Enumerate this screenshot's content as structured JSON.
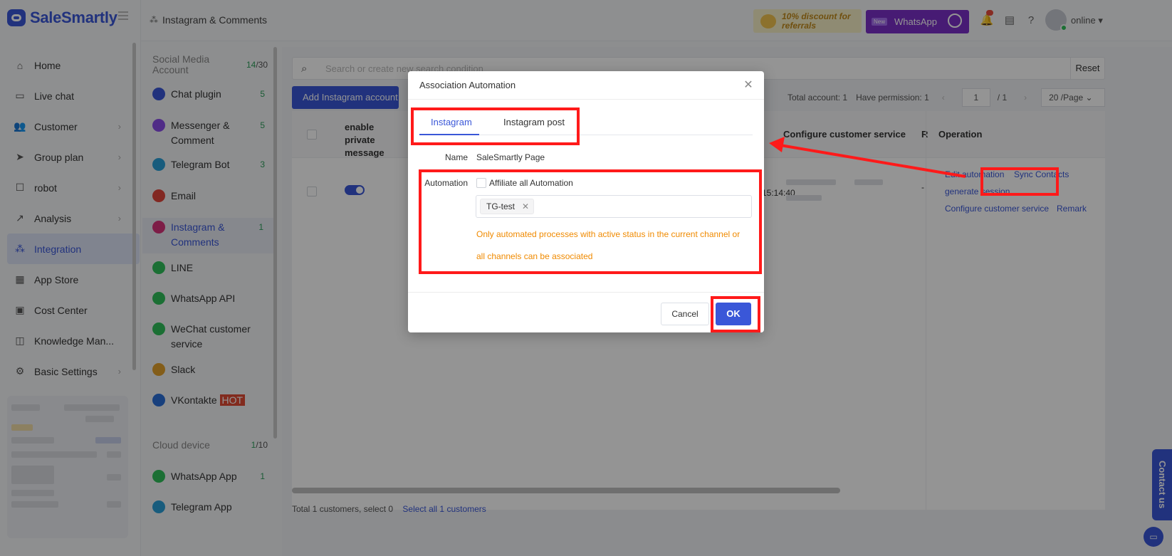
{
  "app": {
    "brand": "SaleSmartly"
  },
  "nav": {
    "items": [
      {
        "label": "Home",
        "icon": "home-icon",
        "glyph": "⌂",
        "chevron": false
      },
      {
        "label": "Live chat",
        "icon": "chat-icon",
        "glyph": "▭",
        "chevron": false
      },
      {
        "label": "Customer",
        "icon": "users-icon",
        "glyph": "👥",
        "chevron": true
      },
      {
        "label": "Group plan",
        "icon": "send-icon",
        "glyph": "➤",
        "chevron": true
      },
      {
        "label": "robot",
        "icon": "robot-icon",
        "glyph": "☐",
        "chevron": true
      },
      {
        "label": "Analysis",
        "icon": "chart-icon",
        "glyph": "↗",
        "chevron": true
      },
      {
        "label": "Integration",
        "icon": "integration-icon",
        "glyph": "⁂",
        "chevron": false,
        "active": true
      },
      {
        "label": "App Store",
        "icon": "apps-icon",
        "glyph": "▦",
        "chevron": false
      },
      {
        "label": "Cost Center",
        "icon": "wallet-icon",
        "glyph": "▣",
        "chevron": false
      },
      {
        "label": "Knowledge Man...",
        "icon": "book-icon",
        "glyph": "◫",
        "chevron": false
      },
      {
        "label": "Basic Settings",
        "icon": "gear-icon",
        "glyph": "⚙",
        "chevron": true
      }
    ],
    "chevron_glyph": "›"
  },
  "topbar": {
    "breadcrumb": "Instagram & Comments",
    "promo_referral": "10% discount for referrals",
    "promo_whatsapp_badge": "New",
    "promo_whatsapp": "WhatsApp",
    "status": "online"
  },
  "subnav": {
    "social_header": "Social Media Account",
    "social_count_used": "14",
    "social_count_total": "/30",
    "items": [
      {
        "label": "Chat plugin",
        "count": "5",
        "color": "#3a57d8"
      },
      {
        "label": "Messenger & Comment",
        "count": "5",
        "color": "#8a4de8"
      },
      {
        "label": "Telegram Bot",
        "count": "3",
        "color": "#2a9fd8"
      },
      {
        "label": "Email",
        "count": "",
        "color": "#e0453b"
      },
      {
        "label": "Instagram & Comments",
        "count": "1",
        "color": "#d8337a",
        "active": true
      },
      {
        "label": "LINE",
        "count": "",
        "color": "#2fbf5b"
      },
      {
        "label": "WhatsApp API",
        "count": "",
        "color": "#2fbf5b"
      },
      {
        "label": "WeChat customer service",
        "count": "",
        "color": "#2fbf5b"
      },
      {
        "label": "Slack",
        "count": "",
        "color": "#e2a12b"
      },
      {
        "label": "VKontakte",
        "count": "",
        "color": "#2a6fd8",
        "hot": "HOT"
      }
    ],
    "cloud_header": "Cloud device",
    "cloud_count_used": "1",
    "cloud_count_total": "/10",
    "cloud_items": [
      {
        "label": "WhatsApp App",
        "count": "1",
        "color": "#2fbf5b"
      },
      {
        "label": "Telegram App",
        "count": "",
        "color": "#2a9fd8"
      }
    ]
  },
  "main": {
    "search_placeholder": "Search or create new search condition",
    "reset": "Reset",
    "add_button": "Add Instagram account",
    "total_account": "Total account: 1",
    "have_permission": "Have permission: 1",
    "page_current": "1",
    "page_total": "/ 1",
    "page_size": "20 /Page",
    "col_enable": "enable private message",
    "col_configure": "Configure customer service",
    "col_r": "R",
    "col_operation": "Operation",
    "time_partial": "15:14:40",
    "dash": "-",
    "ops": {
      "edit_automation": "Edit automation",
      "sync_contacts": "Sync Contacts",
      "generate_session": "generate session",
      "configure_service": "Configure customer service",
      "remark": "Remark"
    },
    "footer_total": "Total 1 customers, select 0",
    "footer_select_all": "Select all 1 customers"
  },
  "contact": {
    "label": "Contact us"
  },
  "modal": {
    "title": "Association Automation",
    "tabs": [
      "Instagram",
      "Instagram post"
    ],
    "name_label": "Name",
    "name_value": "SaleSmartly Page",
    "automation_label": "Automation",
    "affiliate_all": "Affiliate all Automation",
    "tag": "TG-test",
    "warning": "Only automated processes with active status in the current channel or all channels can be associated",
    "cancel": "Cancel",
    "ok": "OK"
  },
  "colors": {
    "accent": "#3a57d8",
    "annotation": "#ff1a1a",
    "warning": "#f08a00"
  }
}
